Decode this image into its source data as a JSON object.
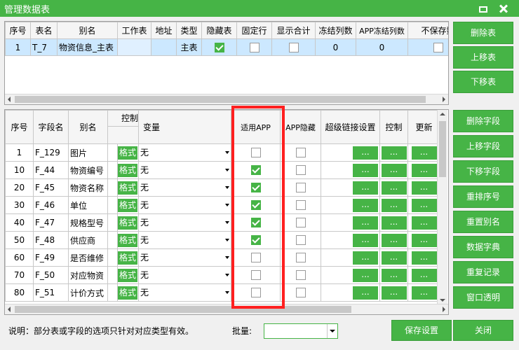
{
  "window": {
    "title": "管理数据表"
  },
  "table_grid": {
    "columns": [
      "序号",
      "表名",
      "别名",
      "工作表",
      "地址",
      "类型",
      "隐藏表",
      "固定行",
      "显示合计",
      "冻结列数",
      "APP冻结列数",
      "不保存数"
    ],
    "rows": [
      {
        "seq": "1",
        "name": "T_7",
        "alias": "物资信息_主表",
        "sheet": "",
        "addr": "",
        "type": "主表",
        "hidden": true,
        "fixed_row": false,
        "show_total": false,
        "frozen_cols": "0",
        "app_frozen_cols": "0",
        "no_save": false
      }
    ]
  },
  "table_buttons": {
    "delete": "删除表",
    "move_up": "上移表",
    "move_down": "下移表"
  },
  "field_grid": {
    "headers": {
      "seq": "序号",
      "field": "字段名",
      "alias": "别名",
      "control_top": "控制",
      "variable": "变量",
      "app_apply": "适用APP",
      "app_hidden": "APP隐藏",
      "hyperlink": "超级链接设置",
      "control": "控制",
      "update": "更新"
    },
    "format_label": "格式",
    "dots_label": "...",
    "rows": [
      {
        "seq": "1",
        "field": "F_129",
        "alias": "图片",
        "variable": "无",
        "app": false,
        "app_hidden": false
      },
      {
        "seq": "10",
        "field": "F_44",
        "alias": "物资编号",
        "variable": "无",
        "app": true,
        "app_hidden": false
      },
      {
        "seq": "20",
        "field": "F_45",
        "alias": "物资名称",
        "variable": "无",
        "app": true,
        "app_hidden": false
      },
      {
        "seq": "30",
        "field": "F_46",
        "alias": "单位",
        "variable": "无",
        "app": true,
        "app_hidden": false
      },
      {
        "seq": "40",
        "field": "F_47",
        "alias": "规格型号",
        "variable": "无",
        "app": true,
        "app_hidden": false
      },
      {
        "seq": "50",
        "field": "F_48",
        "alias": "供应商",
        "variable": "无",
        "app": true,
        "app_hidden": false
      },
      {
        "seq": "60",
        "field": "F_49",
        "alias": "是否维修",
        "variable": "无",
        "app": false,
        "app_hidden": false
      },
      {
        "seq": "70",
        "field": "F_50",
        "alias": "对应物资",
        "variable": "无",
        "app": false,
        "app_hidden": false
      },
      {
        "seq": "80",
        "field": "F_51",
        "alias": "计价方式",
        "variable": "无",
        "app": false,
        "app_hidden": false
      }
    ]
  },
  "field_buttons": [
    "删除字段",
    "上移字段",
    "下移字段",
    "重排序号",
    "重置别名",
    "数据字典",
    "重复记录",
    "窗口透明"
  ],
  "footer": {
    "note": "说明：部分表或字段的选项只针对对应类型有效。",
    "batch_label": "批量:",
    "batch_value": "",
    "save_label": "保存设置",
    "close_label": "关闭"
  },
  "colors": {
    "accent": "#46b446",
    "highlight_border": "#ff2020",
    "selection": "#cce8ff"
  }
}
